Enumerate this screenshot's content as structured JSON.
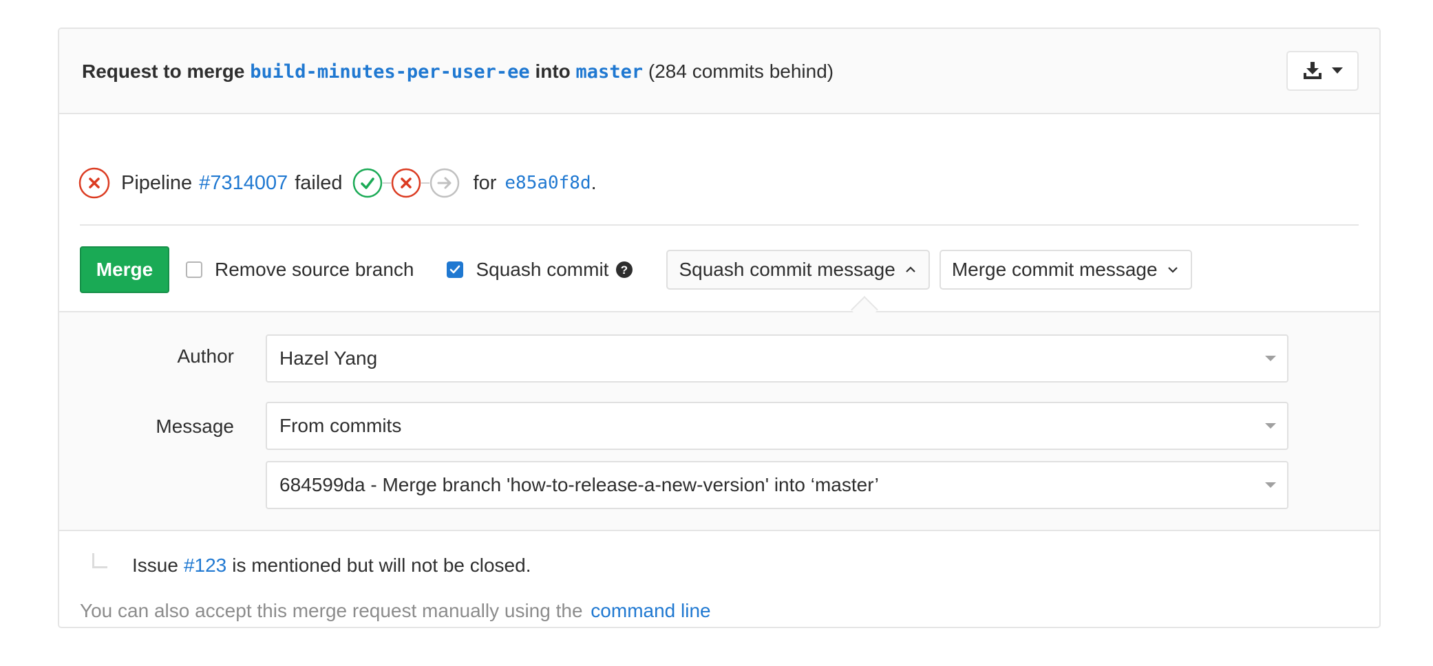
{
  "header": {
    "prefix": "Request to merge",
    "source_branch": "build-minutes-per-user-ee",
    "into_word": "into",
    "target_branch": "master",
    "behind": "(284 commits behind)",
    "download_icon": "download-icon",
    "caret_icon": "caret-down-icon"
  },
  "pipeline": {
    "status_icon": "ci-failed-icon",
    "label": "Pipeline",
    "id": "#7314007",
    "status_text": "failed",
    "stages": [
      {
        "status": "success",
        "icon": "check-icon"
      },
      {
        "status": "failed",
        "icon": "close-icon"
      },
      {
        "status": "skipped",
        "icon": "arrow-right-icon"
      }
    ],
    "for_text": "for",
    "commit": "e85a0f8d",
    "period": "."
  },
  "actions": {
    "merge_label": "Merge",
    "remove_source_label": "Remove source branch",
    "remove_source_checked": false,
    "squash_label": "Squash commit",
    "squash_checked": true,
    "squash_message_btn": "Squash commit message",
    "merge_message_btn": "Merge commit message"
  },
  "commit_form": {
    "author_label": "Author",
    "author_value": "Hazel Yang",
    "message_label": "Message",
    "message_source": "From commits",
    "message_commit": "684599da - Merge branch 'how-to-release-a-new-version' into ‘master’"
  },
  "footer": {
    "issue_prefix": "Issue",
    "issue_ref": "#123",
    "issue_suffix": "is mentioned but will not be closed.",
    "cmd_text": "You can also accept this merge request manually using the",
    "cmd_link": "command line"
  },
  "colors": {
    "link": "#1f78d1",
    "merge_green": "#1aaa55",
    "failed_red": "#db3b21",
    "success_green": "#1aaa55",
    "skipped_gray": "#c0c0c0",
    "checkbox_blue": "#1f78d1"
  }
}
